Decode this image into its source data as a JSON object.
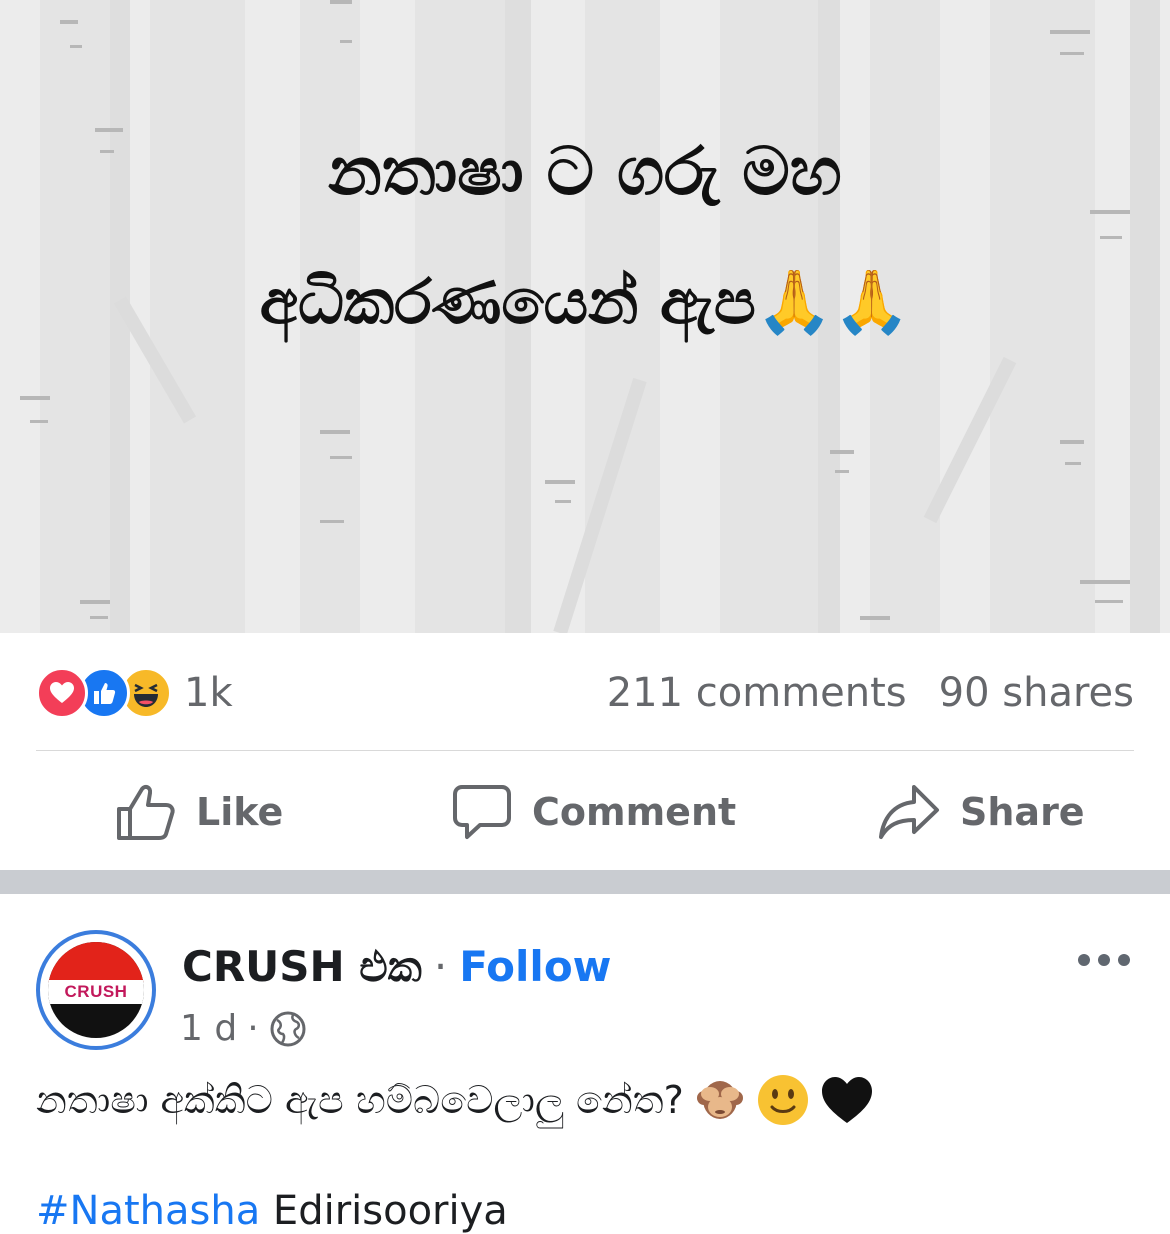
{
  "image_post": {
    "line1": "නතාෂා ට ගරු මහ",
    "line2": "අධිකරණයෙන් ඇප🙏🙏"
  },
  "stats": {
    "reaction_count": "1k",
    "comments": "211 comments",
    "shares": "90 shares",
    "reaction_icons": [
      "love-icon",
      "like-icon",
      "haha-icon"
    ]
  },
  "actions": {
    "like": "Like",
    "comment": "Comment",
    "share": "Share"
  },
  "post": {
    "page_name": "CRUSH එක",
    "separator": "·",
    "follow": "Follow",
    "time": "1 d",
    "meta_separator": "·",
    "avatar_text": "CRUSH",
    "text": "නතාෂා අක්කිට ඇප හම්බවෙලාලු නේත?",
    "emojis": [
      "see-no-evil-monkey",
      "slightly-smiling-face",
      "black-heart"
    ],
    "hashtag_partial": "#Nathasha",
    "text_partial": "Edirisooriya"
  },
  "colors": {
    "accent": "#1877f2",
    "muted_text": "#65676b",
    "divider": "#c9ccd1",
    "love": "#f33e58",
    "haha": "#f7b928"
  }
}
